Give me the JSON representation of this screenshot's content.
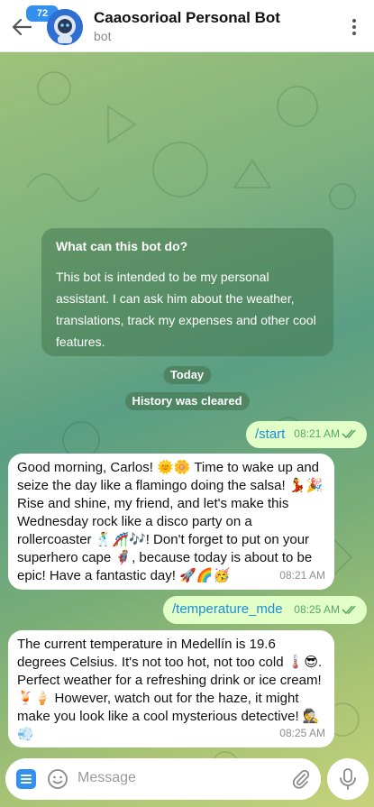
{
  "header": {
    "back_icon": "arrow-left-icon",
    "unread_count": "72",
    "avatar_icon": "robot-astronaut-avatar",
    "title": "Caaosorioal Personal Bot",
    "subtitle": "bot",
    "menu_icon": "more-vertical-icon"
  },
  "info_card": {
    "title": "What can this bot do?",
    "text": "This bot is intended to be my personal assistant. I can ask him about the weather, translations, track my expenses and other cool features."
  },
  "system": {
    "date_label": "Today",
    "history_label": "History was cleared"
  },
  "messages": [
    {
      "direction": "out",
      "text": "/start",
      "time": "08:21 AM",
      "read": true
    },
    {
      "direction": "in",
      "text": "Good morning, Carlos! 🌞🌼 Time to wake up and seize the day like a flamingo doing the salsa! 💃🎉 Rise and shine, my friend, and let's make this Wednesday rock like a disco party on a rollercoaster 🕺🎢🎶! Don't forget to put on your superhero cape 🦸, because today is about to be epic! Have a fantastic day! 🚀🌈🥳",
      "time": "08:21 AM"
    },
    {
      "direction": "out",
      "text": "/temperature_mde",
      "time": "08:25 AM",
      "read": true
    },
    {
      "direction": "in",
      "text": "The current temperature in Medellín is 19.6 degrees Celsius. It's not too hot, not too cold 🌡️😎. Perfect weather for a refreshing drink or ice cream! 🍹🍦 However, watch out for the haze, it might make you look like a cool mysterious detective! 🕵️💨",
      "time": "08:25 AM"
    }
  ],
  "composer": {
    "menu_icon": "bot-menu-icon",
    "emoji_icon": "smile-icon",
    "placeholder": "Message",
    "attach_icon": "paperclip-icon",
    "mic_icon": "microphone-icon"
  },
  "colors": {
    "accent": "#3390ec",
    "outgoing_bubble": "#e2ffc7",
    "incoming_bubble": "#ffffff",
    "command_link": "#1e8ed6"
  }
}
